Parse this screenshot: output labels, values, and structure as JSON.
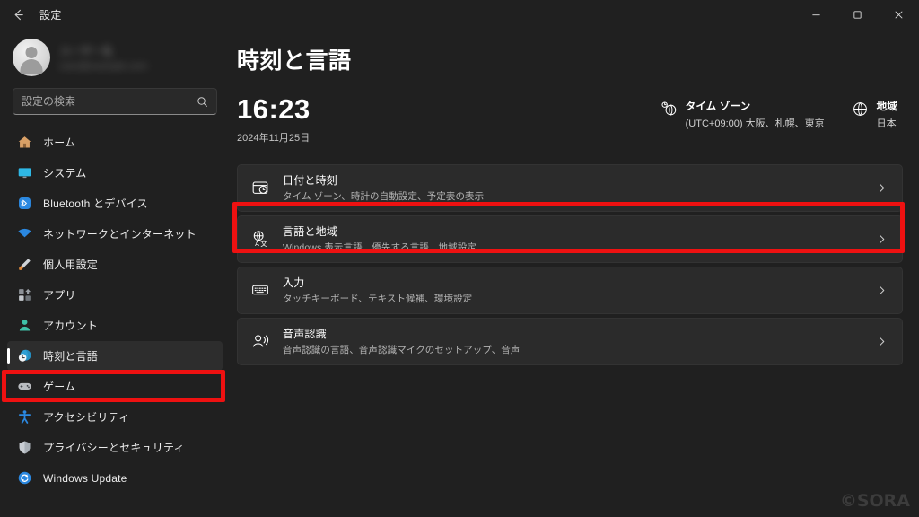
{
  "window": {
    "titlebar_title": "設定",
    "back_icon": "arrow-left-icon",
    "controls": {
      "minimize": "minimize-icon",
      "maximize": "maximize-icon",
      "close": "close-icon"
    }
  },
  "sidebar": {
    "account": {
      "name": "ユーザー名",
      "email": "user@example.com",
      "avatar_icon": "person-avatar-icon",
      "redacted": true
    },
    "search": {
      "placeholder": "設定の検索",
      "value": "",
      "icon": "search-icon"
    },
    "items": [
      {
        "label": "ホーム",
        "icon": "home-icon",
        "color": "#d9a066",
        "selected": false
      },
      {
        "label": "システム",
        "icon": "monitor-icon",
        "color": "#2eb8e6",
        "selected": false
      },
      {
        "label": "Bluetooth とデバイス",
        "icon": "bluetooth-icon",
        "color": "#2b88e0",
        "selected": false
      },
      {
        "label": "ネットワークとインターネット",
        "icon": "wifi-icon",
        "color": "#2b88e0",
        "selected": false
      },
      {
        "label": "個人用設定",
        "icon": "paintbrush-icon",
        "color": "#e08a3c",
        "selected": false
      },
      {
        "label": "アプリ",
        "icon": "apps-grid-icon",
        "color": "#9aa0a6",
        "selected": false
      },
      {
        "label": "アカウント",
        "icon": "person-icon",
        "color": "#3fc1a8",
        "selected": false
      },
      {
        "label": "時刻と言語",
        "icon": "clock-globe-icon",
        "color": "#2e9fd4",
        "selected": true
      },
      {
        "label": "ゲーム",
        "icon": "gamepad-icon",
        "color": "#b9bcc0",
        "selected": false
      },
      {
        "label": "アクセシビリティ",
        "icon": "accessibility-icon",
        "color": "#2b88e0",
        "selected": false
      },
      {
        "label": "プライバシーとセキュリティ",
        "icon": "shield-icon",
        "color": "#c9ced4",
        "selected": false
      },
      {
        "label": "Windows Update",
        "icon": "update-icon",
        "color": "#2b88e0",
        "selected": false
      }
    ]
  },
  "main": {
    "page_title": "時刻と言語",
    "clock": {
      "time": "16:23",
      "date": "2024年11月25日"
    },
    "timezone": {
      "icon": "timezone-globe-icon",
      "title": "タイム ゾーン",
      "value": "(UTC+09:00) 大阪、札幌、東京"
    },
    "region": {
      "icon": "globe-icon",
      "title": "地域",
      "value": "日本"
    },
    "cards": [
      {
        "title": "日付と時刻",
        "subtitle": "タイム ゾーン、時計の自動設定、予定表の表示",
        "icon": "calendar-clock-icon",
        "chevron": "chevron-right-icon",
        "highlighted": false
      },
      {
        "title": "言語と地域",
        "subtitle": "Windows 表示言語、優先する言語、地域設定",
        "icon": "language-globe-icon",
        "chevron": "chevron-right-icon",
        "highlighted": true
      },
      {
        "title": "入力",
        "subtitle": "タッチキーボード、テキスト候補、環境設定",
        "icon": "keyboard-icon",
        "chevron": "chevron-right-icon",
        "highlighted": false
      },
      {
        "title": "音声認識",
        "subtitle": "音声認識の言語、音声認識マイクのセットアップ、音声",
        "icon": "speech-recognition-icon",
        "chevron": "chevron-right-icon",
        "highlighted": false
      }
    ]
  },
  "annotations": {
    "color": "#ee1111",
    "targets": [
      "sidebar-item-time-language",
      "card-language-and-region"
    ]
  },
  "watermark": {
    "text": "©SORA"
  },
  "theme": {
    "background": "#202020",
    "card_background": "#2b2b2b",
    "selected_background": "#2d2d2d",
    "accent": "#4cc2ff",
    "text_primary": "#ffffff",
    "text_secondary": "#b4b4b4"
  }
}
